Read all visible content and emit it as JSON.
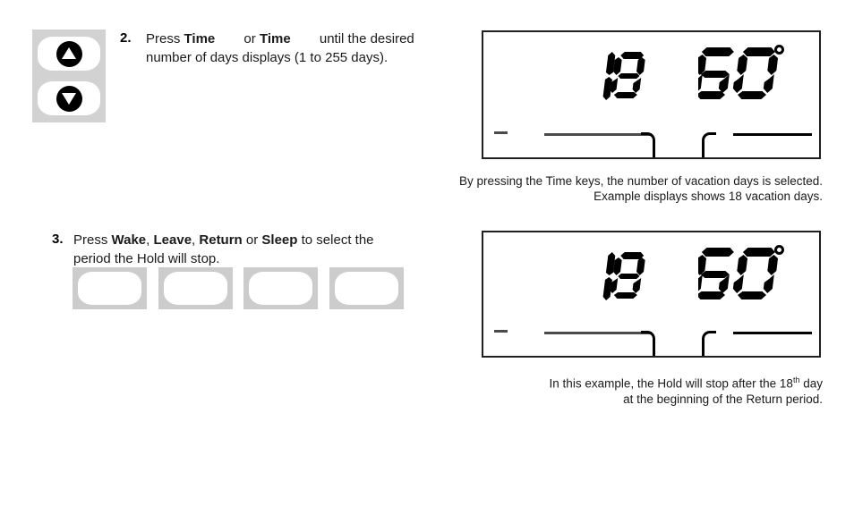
{
  "page": {
    "background_color": "#ffffff",
    "key_face_color": "#ffffff",
    "key_bezel_color": "#cccccc",
    "arrow_bezel_color": "#d2d2d2",
    "lcd_border_color": "#231f20",
    "lcd_segment_color": "#000000",
    "lcd_dim_segment_color": "#4a4a4a"
  },
  "steps": [
    {
      "number": "2.",
      "text_part_1": "Press ",
      "bold_1": "Time",
      "text_part_2": " or ",
      "bold_2": "Time",
      "text_part_3": " until the desired",
      "line_2": "number of days displays (1 to 255 days).",
      "keys": {
        "up_label": "up-arrow-key",
        "down_label": "down-arrow-key"
      }
    },
    {
      "number": "3.",
      "text_part_1": "Press ",
      "bold_1": "Wake",
      "sep_1": ", ",
      "bold_2": "Leave",
      "sep_2": ", ",
      "bold_3": "Return",
      "sep_3": " or ",
      "bold_4": "Sleep",
      "text_part_2": " to select the",
      "line_2": "period the Hold will stop.",
      "keys": [
        {
          "name": "wake-key",
          "label": ""
        },
        {
          "name": "leave-key",
          "label": ""
        },
        {
          "name": "return-key",
          "label": ""
        },
        {
          "name": "sleep-key",
          "label": ""
        }
      ]
    }
  ],
  "displays": [
    {
      "id": "display-top",
      "days_value": "18",
      "temperature_value": "60",
      "degree_symbol": "°",
      "schedule_bar": {
        "left_tick": "dash",
        "left_segment": "active-period-bar",
        "left_hook": "period-end-hook",
        "right_hook": "period-start-hook",
        "right_segment": "next-period-bar"
      }
    },
    {
      "id": "display-bottom",
      "days_value": "18",
      "temperature_value": "60",
      "degree_symbol": "°",
      "schedule_bar": {
        "left_tick": "dash",
        "left_segment": "active-period-bar",
        "left_hook": "period-end-hook",
        "right_hook": "period-start-hook",
        "right_segment": "next-period-bar"
      }
    }
  ],
  "captions": [
    {
      "id": "caption-top",
      "line_1": "By pressing the Time keys, the number of vacation days is selected.",
      "line_2": "Example displays shows 18 vacation days."
    },
    {
      "id": "caption-bottom",
      "line_1_pre": "In this example, the Hold will stop after the 18",
      "line_1_sup": "th",
      "line_1_post": " day",
      "line_2": "at the beginning of the Return period."
    }
  ]
}
